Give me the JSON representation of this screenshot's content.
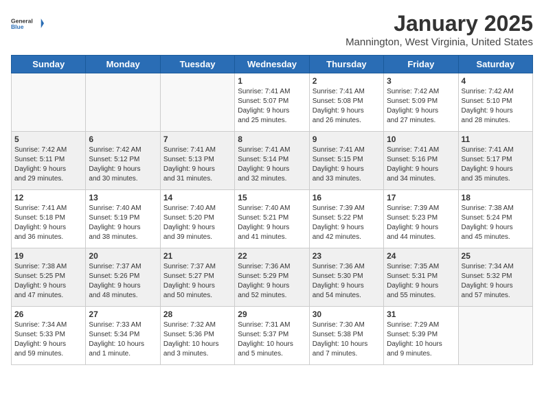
{
  "header": {
    "logo_line1": "General",
    "logo_line2": "Blue",
    "month": "January 2025",
    "location": "Mannington, West Virginia, United States"
  },
  "weekdays": [
    "Sunday",
    "Monday",
    "Tuesday",
    "Wednesday",
    "Thursday",
    "Friday",
    "Saturday"
  ],
  "weeks": [
    [
      {
        "day": "",
        "detail": ""
      },
      {
        "day": "",
        "detail": ""
      },
      {
        "day": "",
        "detail": ""
      },
      {
        "day": "1",
        "detail": "Sunrise: 7:41 AM\nSunset: 5:07 PM\nDaylight: 9 hours\nand 25 minutes."
      },
      {
        "day": "2",
        "detail": "Sunrise: 7:41 AM\nSunset: 5:08 PM\nDaylight: 9 hours\nand 26 minutes."
      },
      {
        "day": "3",
        "detail": "Sunrise: 7:42 AM\nSunset: 5:09 PM\nDaylight: 9 hours\nand 27 minutes."
      },
      {
        "day": "4",
        "detail": "Sunrise: 7:42 AM\nSunset: 5:10 PM\nDaylight: 9 hours\nand 28 minutes."
      }
    ],
    [
      {
        "day": "5",
        "detail": "Sunrise: 7:42 AM\nSunset: 5:11 PM\nDaylight: 9 hours\nand 29 minutes."
      },
      {
        "day": "6",
        "detail": "Sunrise: 7:42 AM\nSunset: 5:12 PM\nDaylight: 9 hours\nand 30 minutes."
      },
      {
        "day": "7",
        "detail": "Sunrise: 7:41 AM\nSunset: 5:13 PM\nDaylight: 9 hours\nand 31 minutes."
      },
      {
        "day": "8",
        "detail": "Sunrise: 7:41 AM\nSunset: 5:14 PM\nDaylight: 9 hours\nand 32 minutes."
      },
      {
        "day": "9",
        "detail": "Sunrise: 7:41 AM\nSunset: 5:15 PM\nDaylight: 9 hours\nand 33 minutes."
      },
      {
        "day": "10",
        "detail": "Sunrise: 7:41 AM\nSunset: 5:16 PM\nDaylight: 9 hours\nand 34 minutes."
      },
      {
        "day": "11",
        "detail": "Sunrise: 7:41 AM\nSunset: 5:17 PM\nDaylight: 9 hours\nand 35 minutes."
      }
    ],
    [
      {
        "day": "12",
        "detail": "Sunrise: 7:41 AM\nSunset: 5:18 PM\nDaylight: 9 hours\nand 36 minutes."
      },
      {
        "day": "13",
        "detail": "Sunrise: 7:40 AM\nSunset: 5:19 PM\nDaylight: 9 hours\nand 38 minutes."
      },
      {
        "day": "14",
        "detail": "Sunrise: 7:40 AM\nSunset: 5:20 PM\nDaylight: 9 hours\nand 39 minutes."
      },
      {
        "day": "15",
        "detail": "Sunrise: 7:40 AM\nSunset: 5:21 PM\nDaylight: 9 hours\nand 41 minutes."
      },
      {
        "day": "16",
        "detail": "Sunrise: 7:39 AM\nSunset: 5:22 PM\nDaylight: 9 hours\nand 42 minutes."
      },
      {
        "day": "17",
        "detail": "Sunrise: 7:39 AM\nSunset: 5:23 PM\nDaylight: 9 hours\nand 44 minutes."
      },
      {
        "day": "18",
        "detail": "Sunrise: 7:38 AM\nSunset: 5:24 PM\nDaylight: 9 hours\nand 45 minutes."
      }
    ],
    [
      {
        "day": "19",
        "detail": "Sunrise: 7:38 AM\nSunset: 5:25 PM\nDaylight: 9 hours\nand 47 minutes."
      },
      {
        "day": "20",
        "detail": "Sunrise: 7:37 AM\nSunset: 5:26 PM\nDaylight: 9 hours\nand 48 minutes."
      },
      {
        "day": "21",
        "detail": "Sunrise: 7:37 AM\nSunset: 5:27 PM\nDaylight: 9 hours\nand 50 minutes."
      },
      {
        "day": "22",
        "detail": "Sunrise: 7:36 AM\nSunset: 5:29 PM\nDaylight: 9 hours\nand 52 minutes."
      },
      {
        "day": "23",
        "detail": "Sunrise: 7:36 AM\nSunset: 5:30 PM\nDaylight: 9 hours\nand 54 minutes."
      },
      {
        "day": "24",
        "detail": "Sunrise: 7:35 AM\nSunset: 5:31 PM\nDaylight: 9 hours\nand 55 minutes."
      },
      {
        "day": "25",
        "detail": "Sunrise: 7:34 AM\nSunset: 5:32 PM\nDaylight: 9 hours\nand 57 minutes."
      }
    ],
    [
      {
        "day": "26",
        "detail": "Sunrise: 7:34 AM\nSunset: 5:33 PM\nDaylight: 9 hours\nand 59 minutes."
      },
      {
        "day": "27",
        "detail": "Sunrise: 7:33 AM\nSunset: 5:34 PM\nDaylight: 10 hours\nand 1 minute."
      },
      {
        "day": "28",
        "detail": "Sunrise: 7:32 AM\nSunset: 5:36 PM\nDaylight: 10 hours\nand 3 minutes."
      },
      {
        "day": "29",
        "detail": "Sunrise: 7:31 AM\nSunset: 5:37 PM\nDaylight: 10 hours\nand 5 minutes."
      },
      {
        "day": "30",
        "detail": "Sunrise: 7:30 AM\nSunset: 5:38 PM\nDaylight: 10 hours\nand 7 minutes."
      },
      {
        "day": "31",
        "detail": "Sunrise: 7:29 AM\nSunset: 5:39 PM\nDaylight: 10 hours\nand 9 minutes."
      },
      {
        "day": "",
        "detail": ""
      }
    ]
  ]
}
